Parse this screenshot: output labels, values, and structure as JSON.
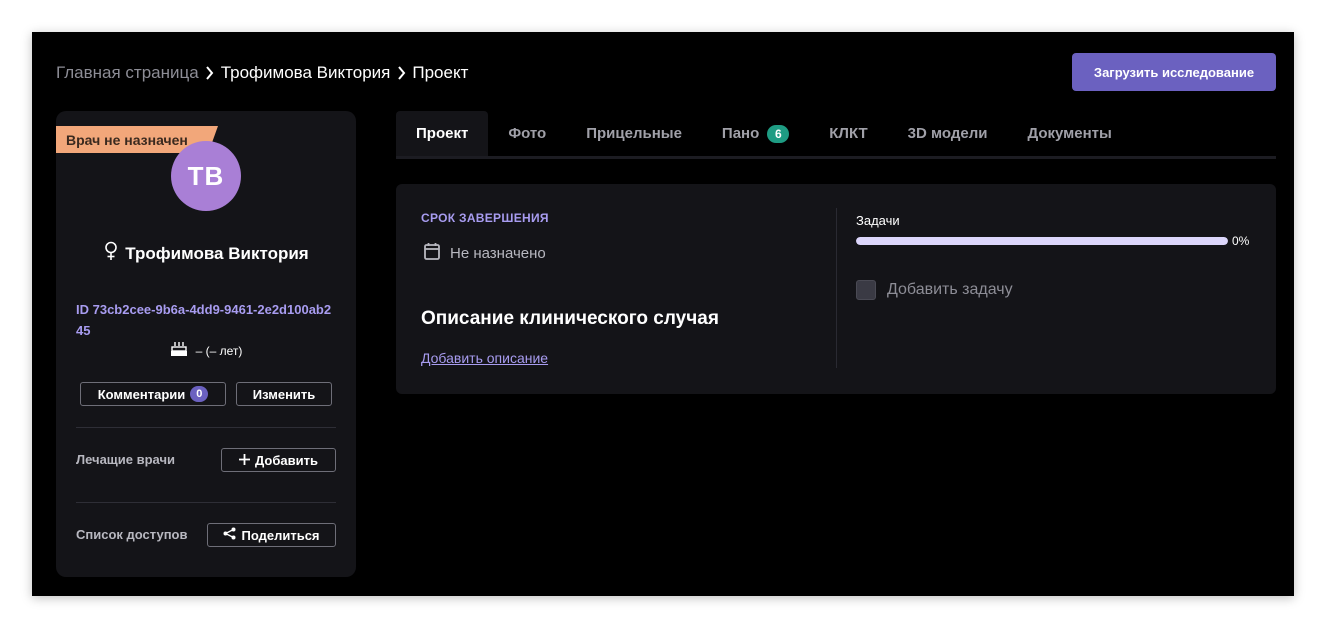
{
  "breadcrumb": {
    "home": "Главная страница",
    "patient": "Трофимова Виктория",
    "current": "Проект"
  },
  "header": {
    "upload_label": "Загрузить исследование"
  },
  "patient": {
    "ribbon": "Врач не назначен",
    "initials": "ТВ",
    "name": "Трофимова Виктория",
    "id_text": "ID 73cb2cee-9b6a-4dd9-9461-2e2d100ab245",
    "birth": "– (– лет)",
    "comments_label": "Комментарии",
    "comments_count": "0",
    "edit_label": "Изменить",
    "doctors_label": "Лечащие врачи",
    "add_label": "Добавить",
    "access_label": "Список доступов",
    "share_label": "Поделиться"
  },
  "tabs": [
    {
      "label": "Проект",
      "active": true
    },
    {
      "label": "Фото"
    },
    {
      "label": "Прицельные"
    },
    {
      "label": "Пано",
      "badge": "6"
    },
    {
      "label": "КЛКТ"
    },
    {
      "label": "3D модели"
    },
    {
      "label": "Документы"
    }
  ],
  "project": {
    "deadline_label": "СРОК ЗАВЕРШЕНИЯ",
    "deadline_value": "Не назначено",
    "case_title": "Описание клинического случая",
    "add_description": "Добавить описание",
    "tasks_label": "Задачи",
    "tasks_progress": 1.0,
    "tasks_percent": "0%",
    "add_task": "Добавить задачу"
  },
  "colors": {
    "accent": "#6b61c0",
    "link": "#a89cf0",
    "ribbon": "#f2a77a",
    "avatar": "#a97fd6",
    "badge_teal": "#1e9c83"
  }
}
